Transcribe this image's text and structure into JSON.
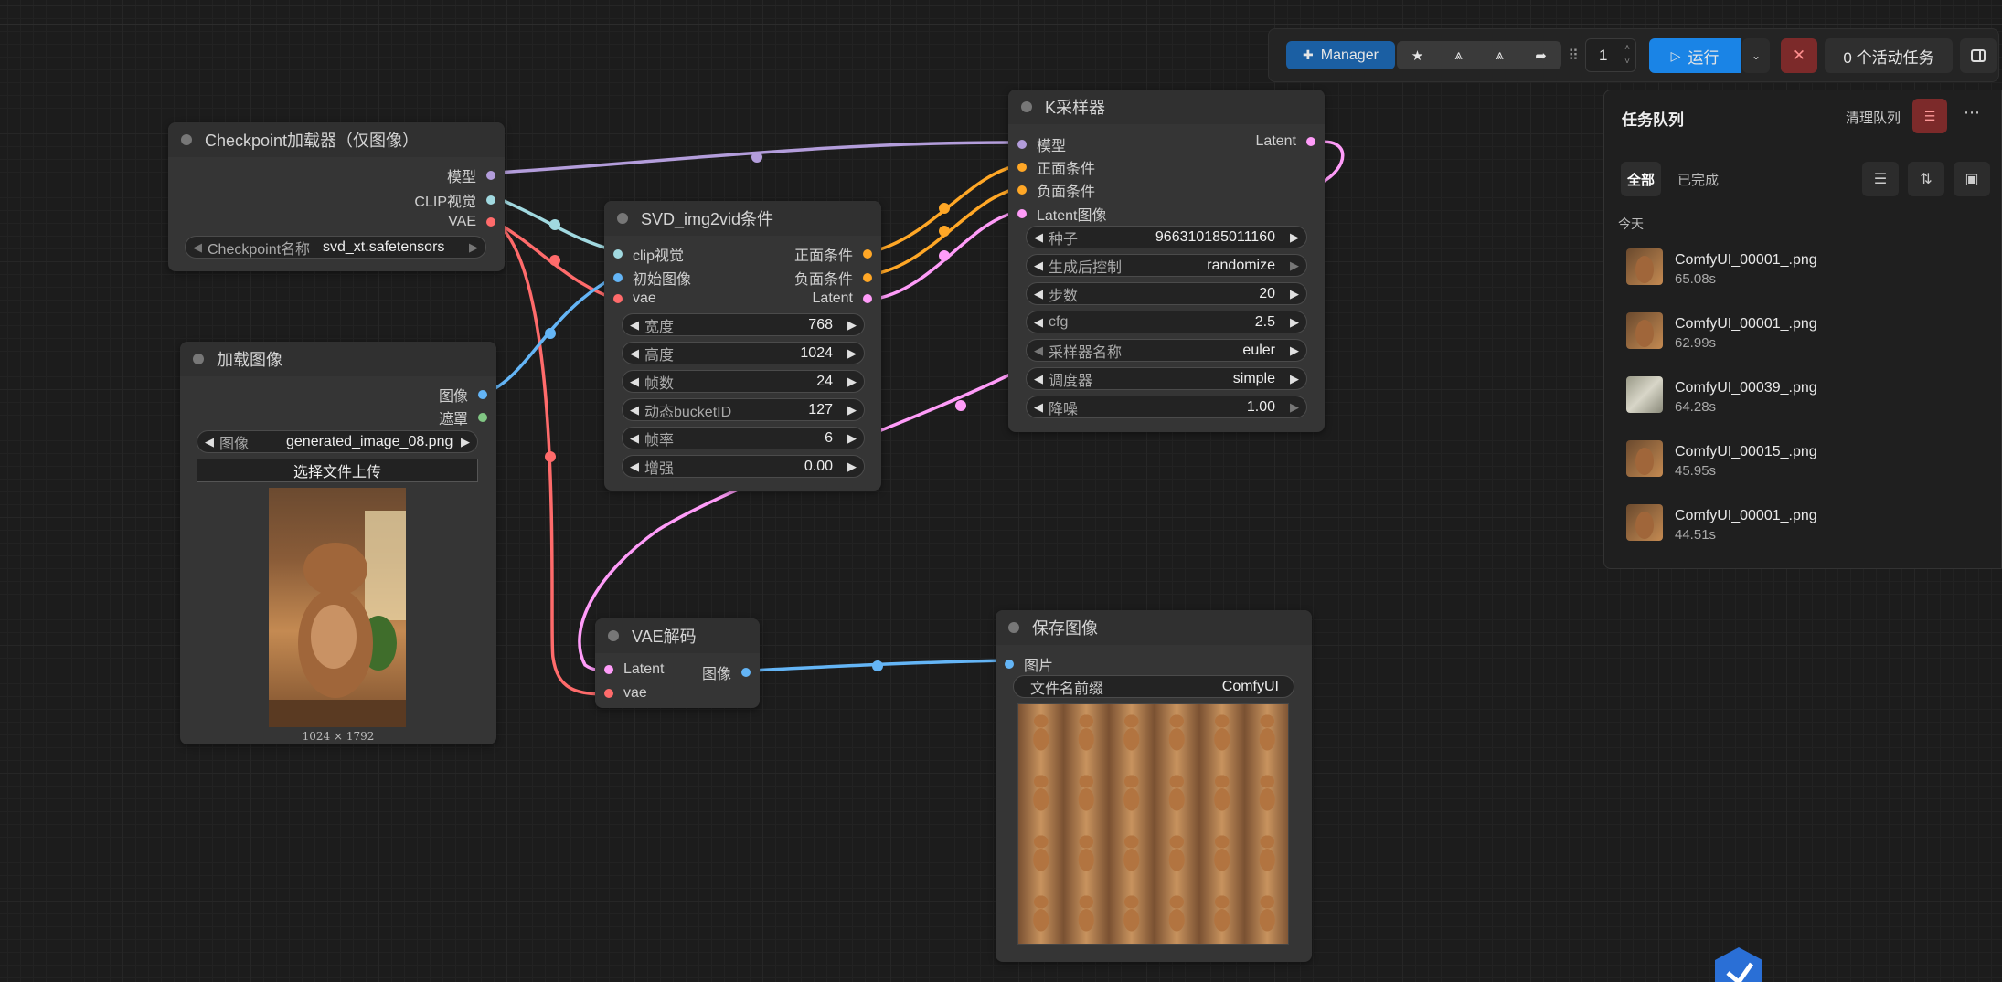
{
  "topbar": {
    "manager_label": "Manager",
    "batch_count": "1",
    "run_label": "运行",
    "active_tasks": "0 个活动任务"
  },
  "queue": {
    "title": "任务队列",
    "clear_label": "清理队列",
    "tab_all": "全部",
    "tab_done": "已完成",
    "section_today": "今天",
    "items": [
      {
        "name": "ComfyUI_00001_.png",
        "time": "65.08s"
      },
      {
        "name": "ComfyUI_00001_.png",
        "time": "62.99s"
      },
      {
        "name": "ComfyUI_00039_.png",
        "time": "64.28s"
      },
      {
        "name": "ComfyUI_00015_.png",
        "time": "45.95s"
      },
      {
        "name": "ComfyUI_00001_.png",
        "time": "44.51s"
      }
    ]
  },
  "nodes": {
    "checkpoint": {
      "title": "Checkpoint加载器（仅图像）",
      "out_model": "模型",
      "out_clip": "CLIP视觉",
      "out_vae": "VAE",
      "w_label": "Checkpoint名称",
      "w_value": "svd_xt.safetensors"
    },
    "load_image": {
      "title": "加载图像",
      "out_image": "图像",
      "out_mask": "遮罩",
      "w_label": "图像",
      "w_value": "generated_image_08.png",
      "upload_label": "选择文件上传",
      "caption": "1024 × 1792"
    },
    "svd": {
      "title": "SVD_img2vid条件",
      "in_clip": "clip视觉",
      "in_init": "初始图像",
      "in_vae": "vae",
      "out_pos": "正面条件",
      "out_neg": "负面条件",
      "out_latent": "Latent",
      "widgets": [
        {
          "label": "宽度",
          "value": "768"
        },
        {
          "label": "高度",
          "value": "1024"
        },
        {
          "label": "帧数",
          "value": "24"
        },
        {
          "label": "动态bucketID",
          "value": "127"
        },
        {
          "label": "帧率",
          "value": "6"
        },
        {
          "label": "增强",
          "value": "0.00"
        }
      ]
    },
    "ksampler": {
      "title": "K采样器",
      "in_model": "模型",
      "in_pos": "正面条件",
      "in_neg": "负面条件",
      "in_latent": "Latent图像",
      "out_latent": "Latent",
      "widgets": [
        {
          "label": "种子",
          "value": "966310185011160"
        },
        {
          "label": "生成后控制",
          "value": "randomize"
        },
        {
          "label": "步数",
          "value": "20"
        },
        {
          "label": "cfg",
          "value": "2.5"
        },
        {
          "label": "采样器名称",
          "value": "euler"
        },
        {
          "label": "调度器",
          "value": "simple"
        },
        {
          "label": "降噪",
          "value": "1.00"
        }
      ]
    },
    "vae_decode": {
      "title": "VAE解码",
      "in_latent": "Latent",
      "in_vae": "vae",
      "out_image": "图像"
    },
    "save_image": {
      "title": "保存图像",
      "in_images": "图片",
      "w_label": "文件名前缀",
      "w_value": "ComfyUI"
    }
  },
  "colors": {
    "model": "#b39ddb",
    "clip_vision": "#a1d9e0",
    "vae": "#ff6b6b",
    "image": "#64b5f6",
    "conditioning": "#ffa726",
    "latent": "#ff9cf9",
    "mask": "#81c784",
    "run_button": "#1a84e6",
    "manager_button": "#1b5fa3",
    "danger": "#7c2a2a"
  }
}
